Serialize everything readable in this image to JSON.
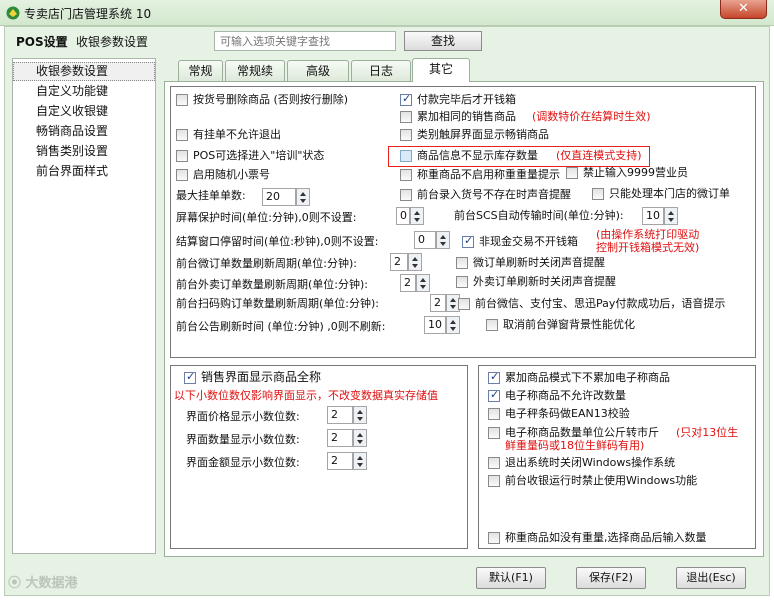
{
  "window": {
    "title": "专卖店门店管理系统 10",
    "close": "✕"
  },
  "header": {
    "pos_label": "POS设置",
    "sub_label": "收银参数设置",
    "search_placeholder": "可输入选项关键字查找",
    "search_btn": "查找"
  },
  "sidebar": {
    "items": [
      "收银参数设置",
      "自定义功能键",
      "自定义收银键",
      "畅销商品设置",
      "销售类别设置",
      "前台界面样式"
    ]
  },
  "tabs": [
    "常规",
    "常规续",
    "高级",
    "日志",
    "其它"
  ],
  "main": {
    "del_cb": "按货号删除商品 (否则按行删除)",
    "pay_drawer": "付款完毕后才开钱箱",
    "merge_same": "累加相同的销售商品",
    "merge_note": "(调数特价在结算时生效)",
    "no_hang_exit": "有挂单不允许退出",
    "category_show": "类别触屏界面显示畅销商品",
    "training": "POS可选择进入\"培训\"状态",
    "no_stock": "商品信息不显示库存数量",
    "no_stock_note": "(仅直连模式支持)",
    "random_ticket": "启用随机小票号",
    "weigh_no_remind": "称重商品不启用称重重量提示",
    "forbid_9999": "禁止输入9999营业员",
    "max_hang": "最大挂单单数:",
    "max_hang_val": "20",
    "front_not_exist": "前台录入货号不存在时声音提醒",
    "only_store": "只能处理本门店的微订单",
    "screensaver": "屏幕保护时间(单位:分钟),0则不设置:",
    "screensaver_val": "0",
    "scs_time": "前台SCS自动传输时间(单位:分钟):",
    "scs_val": "10",
    "settle_stay": "结算窗口停留时间(单位:秒钟),0则不设置:",
    "settle_val": "0",
    "noncash": "非现金交易不开钱箱",
    "noncash_note1": "(由操作系统打印驱动",
    "noncash_note2": "控制开钱箱模式无效)",
    "wx_refresh": "前台微订单数量刷新周期(单位:分钟):",
    "wx_val": "2",
    "wx_sound": "微订单刷新时关闭声音提醒",
    "takeout_refresh": "前台外卖订单数量刷新周期(单位:分钟):",
    "takeout_val": "2",
    "takeout_sound": "外卖订单刷新时关闭声音提醒",
    "scan_refresh": "前台扫码购订单数量刷新周期(单位:分钟):",
    "scan_val": "2",
    "pay_voice": "前台微信、支付宝、思迅Pay付款成功后，语音提示",
    "notice_refresh": "前台公告刷新时间 (单位:分钟) ,0则不刷新:",
    "notice_val": "10",
    "cancel_popup": "取消前台弹窗背景性能优化"
  },
  "bottom_left": {
    "show_full": "销售界面显示商品全称",
    "note": "以下小数位数仅影响界面显示，不改变数据真实存储值",
    "price_dec": "界面价格显示小数位数:",
    "price_val": "2",
    "qty_dec": "界面数量显示小数位数:",
    "qty_val": "2",
    "amt_dec": "界面金额显示小数位数:",
    "amt_val": "2"
  },
  "bottom_right": {
    "no_accum_e": "累加商品模式下不累加电子称商品",
    "e_no_modify": "电子称商品不允许改数量",
    "e_ean13": "电子秤条码做EAN13校验",
    "e_unit_kg": "电子称商品数量单位公斤转市斤",
    "e_unit_note1": "(只对13位生",
    "e_unit_note2": "鲜重量码或18位生鲜码有用)",
    "exit_close": "退出系统时关闭Windows操作系统",
    "forbid_win": "前台收银运行时禁止使用Windows功能",
    "weigh_input": "称重商品如没有重量,选择商品后输入数量"
  },
  "footer": {
    "logo": "大数据港",
    "default_btn": "默认(F1)",
    "save_btn": "保存(F2)",
    "exit_btn": "退出(Esc)"
  },
  "colors": {
    "accent_red": "#e01010",
    "frame_green": "#e6f2e3"
  }
}
